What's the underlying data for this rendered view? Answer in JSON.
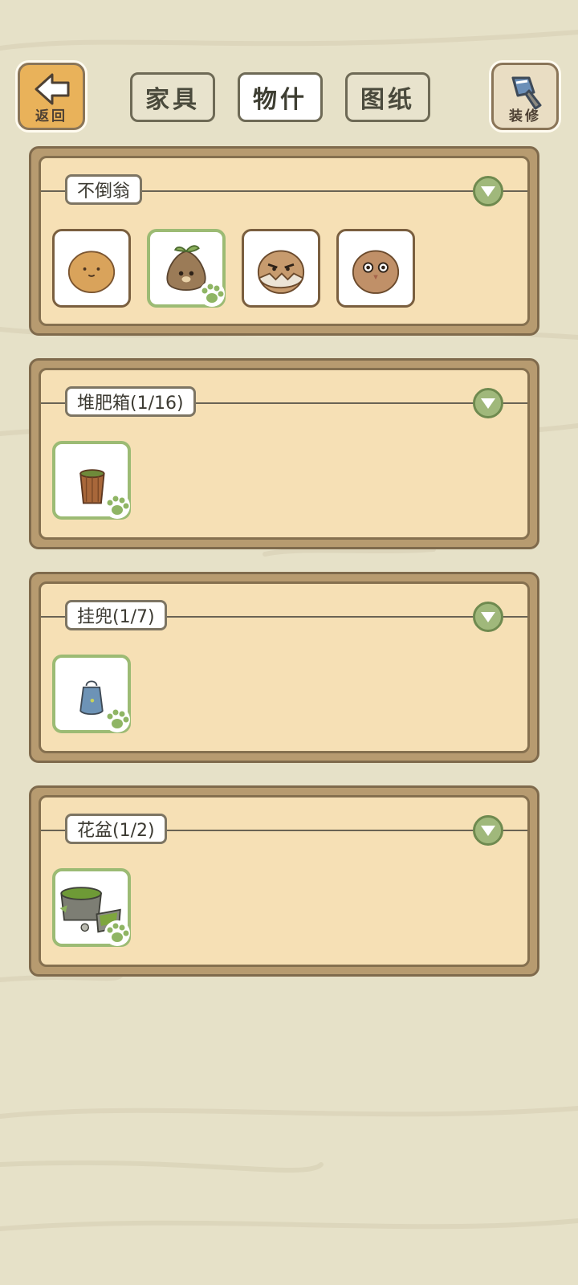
{
  "header": {
    "back_label": "返回",
    "decorate_label": "装修",
    "tabs": [
      {
        "label": "家具",
        "active": false
      },
      {
        "label": "物什",
        "active": true
      },
      {
        "label": "图纸",
        "active": false
      }
    ]
  },
  "categories": [
    {
      "title": "不倒翁",
      "items": [
        "plain-tumbler",
        "sprout-tumbler",
        "grumpy-tumbler",
        "owl-tumbler"
      ]
    },
    {
      "title": "堆肥箱(1/16)",
      "items": [
        "compost-bucket"
      ]
    },
    {
      "title": "挂兜(1/7)",
      "items": [
        "hanging-pouch"
      ]
    },
    {
      "title": "花盆(1/2)",
      "items": [
        "moss-flower-pot"
      ]
    }
  ],
  "colors": {
    "background": "#e6e1c8",
    "panel_frame": "#b79b70",
    "panel_fill": "#f6e0b5",
    "owned_border": "#9cbb74",
    "accent_green": "#a0b87b"
  }
}
